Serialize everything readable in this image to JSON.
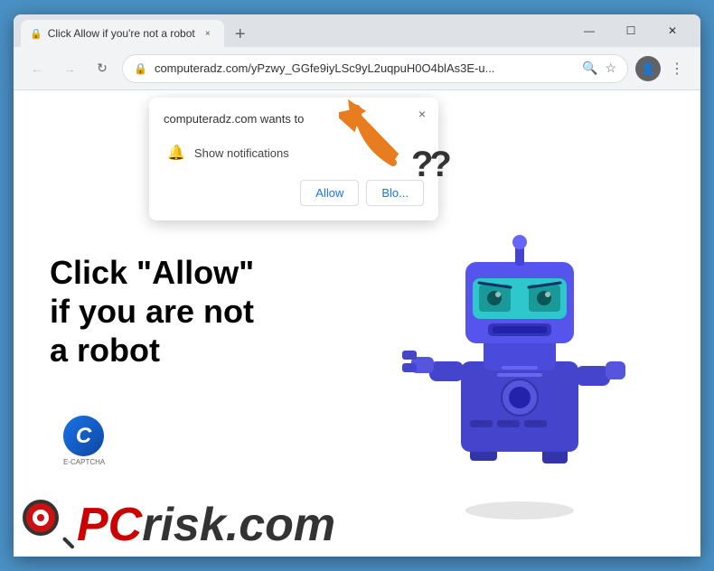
{
  "browser": {
    "tab": {
      "favicon": "🔒",
      "title": "Click Allow if you're not a robot",
      "close": "×"
    },
    "new_tab": "+",
    "window_controls": {
      "minimize": "—",
      "maximize": "☐",
      "close": "✕"
    },
    "toolbar": {
      "back": "←",
      "forward": "→",
      "reload": "↻",
      "url": "computeradz.com/yPzwy_GGfe9iyLSc9yL2uqpuH0O4blAs3E-u...",
      "search_icon": "🔍",
      "star": "☆",
      "profile": "👤",
      "menu": "⋮"
    }
  },
  "notification_popup": {
    "title": "computeradz.com wants to",
    "option": "Show notifications",
    "close": "×",
    "allow_label": "Allow",
    "block_label": "Blo..."
  },
  "page": {
    "main_text_line1": "Click \"Allow\"",
    "main_text_line2": "if you are not",
    "main_text_line3": "a robot",
    "question_marks": "??",
    "ecaptcha_text": "E-CAPTCHA",
    "pcrisk_text": "PC",
    "pcrisk_com": "risk.com"
  },
  "colors": {
    "browser_frame": "#4a90c4",
    "tab_bar_bg": "#dee1e6",
    "content_bg": "#ffffff",
    "robot_blue": "#4444cc",
    "arrow_color": "#e87d20",
    "text_black": "#000000",
    "pcrisk_red": "#cc0000"
  }
}
